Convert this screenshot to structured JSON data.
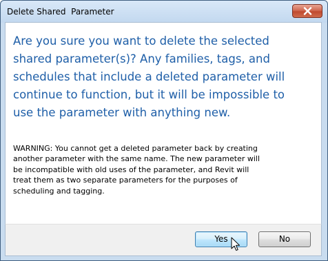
{
  "window": {
    "title": "Delete Shared  Parameter",
    "close_icon": "close-icon"
  },
  "message": {
    "question_lines": [
      "Are you sure you want to delete the selected",
      "shared parameter(s)? Any families, tags, and",
      "schedules that include a deleted parameter will",
      "continue to function, but it will be impossible to",
      "use the parameter with anything new."
    ],
    "warning_lines": [
      "WARNING: You cannot get a deleted parameter back by creating",
      "another parameter with the same name.  The new parameter will",
      "be incompatible with old uses of the parameter, and Revit will",
      "treat them as two separate parameters for the purposes of",
      "scheduling and tagging."
    ]
  },
  "buttons": {
    "yes_label": "Yes",
    "no_label": "No"
  },
  "colors": {
    "question_text": "#1f5fa8",
    "title_bar": "#c9dcef",
    "close_button": "#c04a2f"
  },
  "cursor_icon": "arrow-pointer-icon"
}
